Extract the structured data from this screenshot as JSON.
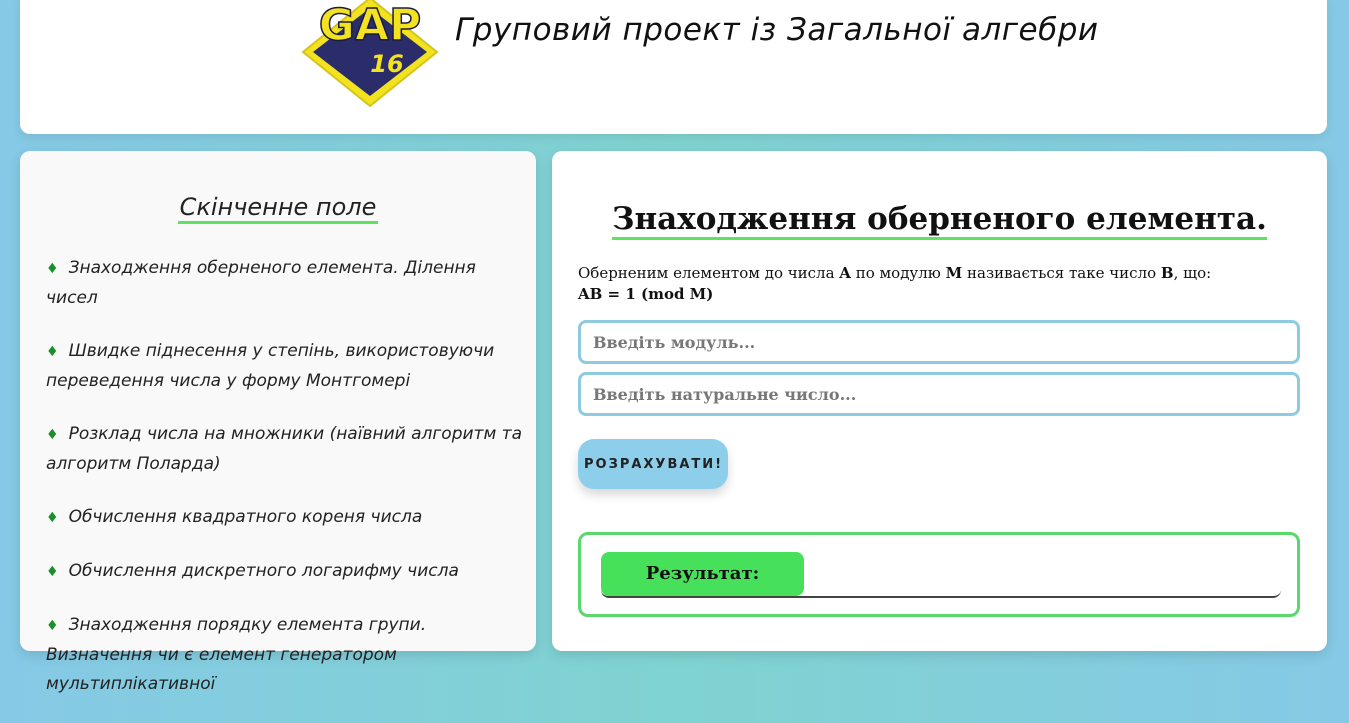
{
  "header": {
    "logo_text": "GAP",
    "logo_number": "16",
    "title": "Груповий проект із Загальної алгебри"
  },
  "sidebar": {
    "title": "Скінченне поле",
    "bullet": "♦",
    "items": [
      {
        "label": "Знаходження оберненого елемента. Ділення чисел"
      },
      {
        "label": "Швидке піднесення у степінь, використовуючи переведення числа у форму Монтгомері"
      },
      {
        "label": "Розклад числа на множники (наївний алгоритм та алгоритм Поларда)"
      },
      {
        "label": "Обчислення квадратного кореня числа"
      },
      {
        "label": "Обчислення дискретного логарифму числа"
      },
      {
        "label": "Знаходження порядку елемента групи. Визначення чи є елемент генератором мультиплікативної"
      }
    ]
  },
  "main": {
    "title": "Знаходження оберненого елемента.",
    "desc_pre": "Оберненим елементом до числа ",
    "desc_a": "A",
    "desc_mid1": " по модулю ",
    "desc_m": "M",
    "desc_mid2": " називається таке число ",
    "desc_b": "B",
    "desc_post": ", що:",
    "formula": "AB = 1 (mod M)",
    "modulus_placeholder": "Введіть модуль...",
    "number_placeholder": "Введіть натуральне число...",
    "calc_button": "РОЗРАХУВАТИ!",
    "result_label": "Результат:"
  },
  "colors": {
    "accent_green": "#47e05a",
    "input_border": "#8fcbe0",
    "button_blue": "#8dcfeb",
    "logo_yellow": "#f2e21f",
    "logo_navy": "#2b2d6b"
  }
}
